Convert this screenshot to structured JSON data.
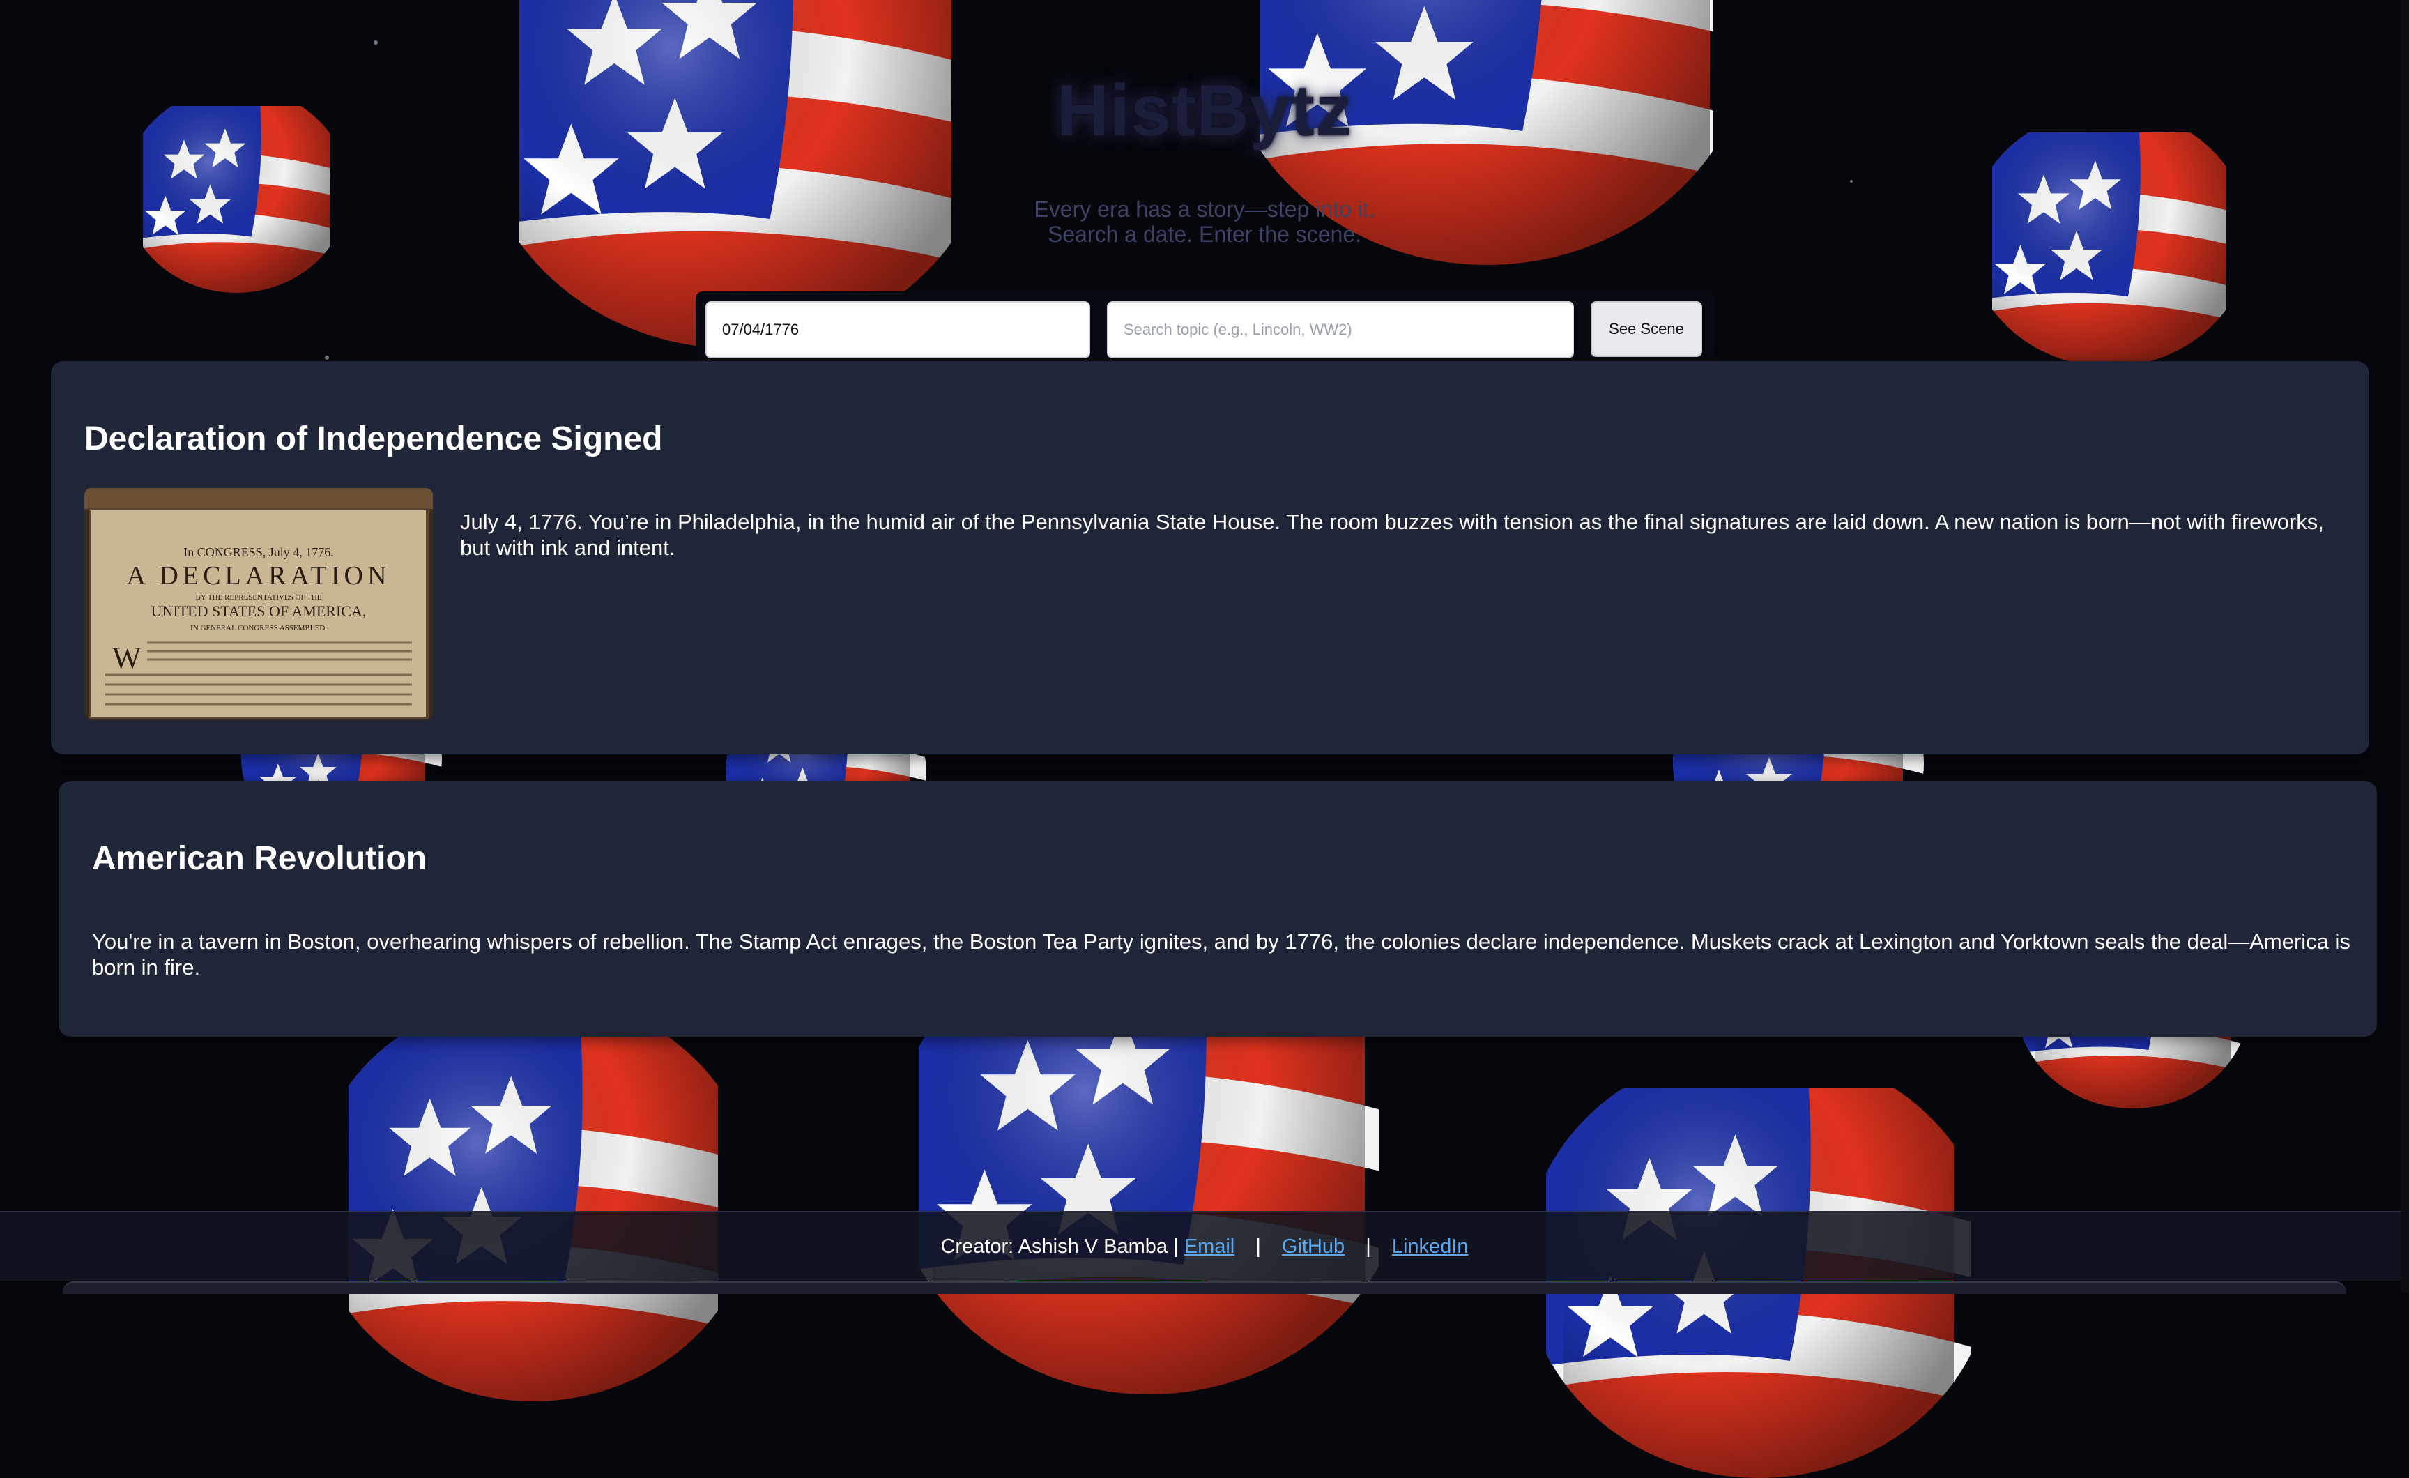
{
  "app": {
    "title": "HistBytz",
    "tagline_line1": "Every era has a story—step into it.",
    "tagline_line2": "Search a date. Enter the scene."
  },
  "search": {
    "date_value": "07/04/1776",
    "topic_placeholder": "Search topic (e.g., Lincoln, WW2)",
    "button_label": "See Scene"
  },
  "cards": [
    {
      "title": "Declaration of Independence Signed",
      "body": "July 4, 1776. You’re in Philadelphia, in the humid air of the Pennsylvania State House. The room buzzes with tension as the final signatures are laid down. A new nation is born—not with fireworks, but with ink and intent.",
      "image_text": {
        "line1": "In CONGRESS, July 4, 1776.",
        "line2": "A DECLARATION",
        "line3": "BY THE REPRESENTATIVES OF THE",
        "line4": "UNITED STATES OF AMERICA,",
        "line5": "IN GENERAL CONGRESS ASSEMBLED."
      }
    },
    {
      "title": "American Revolution",
      "body": "You're in a tavern in Boston, overhearing whispers of rebellion. The Stamp Act enrages, the Boston Tea Party ignites, and by 1776, the colonies declare independence. Muskets crack at Lexington and Yorktown seals the deal—America is born in fire."
    }
  ],
  "footer": {
    "creator": "Creator: Ashish V Bamba |",
    "email": "Email",
    "github": "GitHub",
    "linkedin": "LinkedIn",
    "separator": "|"
  },
  "colors": {
    "background": "#05070d",
    "card": "#1f2637",
    "flag_blue": "#1b2fa8",
    "flag_red": "#e0331f",
    "flag_white": "#f2f2f2",
    "link": "#5aa9f0"
  }
}
